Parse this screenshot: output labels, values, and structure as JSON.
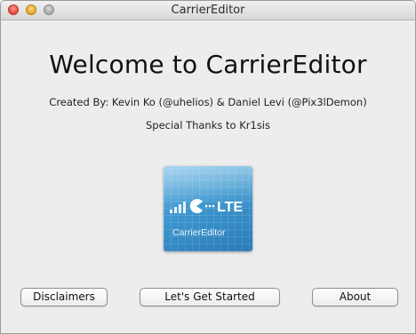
{
  "window": {
    "title": "CarrierEditor"
  },
  "main": {
    "heading": "Welcome to CarrierEditor",
    "credits": "Created By: Kevin Ko (@uhelios) & Daniel Levi (@Pix3lDemon)",
    "thanks": "Special Thanks to Kr1sis"
  },
  "logo": {
    "badge_text": "LTE",
    "caption": "CarrierEditor",
    "icon": "signal-bars-pacman-lte-icon"
  },
  "buttons": {
    "disclaimers": "Disclaimers",
    "get_started": "Let's Get Started",
    "about": "About"
  },
  "colors": {
    "close": "#e2463f",
    "minimize": "#e3a526",
    "zoom": "#a9a9a9",
    "logo_blue": "#3e97cf"
  }
}
